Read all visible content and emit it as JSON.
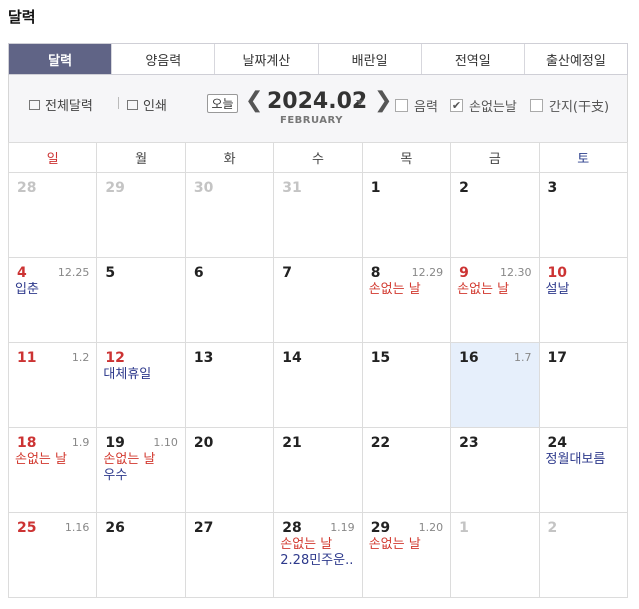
{
  "title": "달력",
  "tabs": [
    "달력",
    "양음력",
    "날짜계산",
    "배란일",
    "전역일",
    "출산예정일"
  ],
  "toolbar": {
    "full_calendar": "전체달력",
    "print": "인쇄",
    "today": "오늘",
    "prev": "❮",
    "next": "❯",
    "year_month": "2024.02",
    "month_en": "FEBRUARY",
    "options": [
      {
        "label": "음력",
        "checked": false
      },
      {
        "label": "손없는날",
        "checked": true
      },
      {
        "label": "간지(干支)",
        "checked": false
      }
    ]
  },
  "weekdays": [
    "일",
    "월",
    "화",
    "수",
    "목",
    "금",
    "토"
  ],
  "weeks": [
    [
      {
        "day": "28",
        "other": true
      },
      {
        "day": "29",
        "other": true
      },
      {
        "day": "30",
        "other": true
      },
      {
        "day": "31",
        "other": true
      },
      {
        "day": "1"
      },
      {
        "day": "2"
      },
      {
        "day": "3"
      }
    ],
    [
      {
        "day": "4",
        "lunar": "12.25",
        "holiday": true,
        "events": [
          {
            "text": "입춘",
            "color": "blue"
          }
        ]
      },
      {
        "day": "5"
      },
      {
        "day": "6"
      },
      {
        "day": "7"
      },
      {
        "day": "8",
        "lunar": "12.29",
        "events": [
          {
            "text": "손없는 날",
            "color": "red"
          }
        ]
      },
      {
        "day": "9",
        "lunar": "12.30",
        "holiday": true,
        "events": [
          {
            "text": "손없는 날",
            "color": "red"
          }
        ]
      },
      {
        "day": "10",
        "holiday": true,
        "events": [
          {
            "text": "설날",
            "color": "blue"
          }
        ]
      }
    ],
    [
      {
        "day": "11",
        "lunar": "1.2",
        "holiday": true
      },
      {
        "day": "12",
        "holiday": true,
        "events": [
          {
            "text": "대체휴일",
            "color": "blue"
          }
        ]
      },
      {
        "day": "13"
      },
      {
        "day": "14"
      },
      {
        "day": "15"
      },
      {
        "day": "16",
        "lunar": "1.7",
        "today": true
      },
      {
        "day": "17"
      }
    ],
    [
      {
        "day": "18",
        "lunar": "1.9",
        "holiday": true,
        "events": [
          {
            "text": "손없는 날",
            "color": "red"
          }
        ]
      },
      {
        "day": "19",
        "lunar": "1.10",
        "events": [
          {
            "text": "손없는 날",
            "color": "red"
          },
          {
            "text": "우수",
            "color": "blue"
          }
        ]
      },
      {
        "day": "20"
      },
      {
        "day": "21"
      },
      {
        "day": "22"
      },
      {
        "day": "23"
      },
      {
        "day": "24",
        "events": [
          {
            "text": "정월대보름",
            "color": "blue"
          }
        ]
      }
    ],
    [
      {
        "day": "25",
        "lunar": "1.16",
        "holiday": true
      },
      {
        "day": "26"
      },
      {
        "day": "27"
      },
      {
        "day": "28",
        "lunar": "1.19",
        "events": [
          {
            "text": "손없는 날",
            "color": "red"
          },
          {
            "text": "2.28민주운..",
            "color": "blue"
          }
        ]
      },
      {
        "day": "29",
        "lunar": "1.20",
        "events": [
          {
            "text": "손없는 날",
            "color": "red"
          }
        ]
      },
      {
        "day": "1",
        "other": true
      },
      {
        "day": "2",
        "other": true
      }
    ]
  ]
}
